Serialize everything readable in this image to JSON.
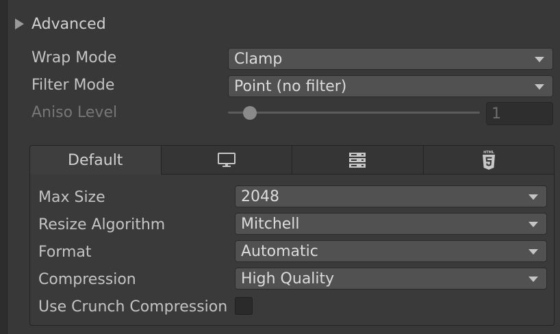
{
  "foldout": {
    "label": "Advanced",
    "expanded": false
  },
  "fields": {
    "wrap_mode": {
      "label": "Wrap Mode",
      "value": "Clamp"
    },
    "filter_mode": {
      "label": "Filter Mode",
      "value": "Point (no filter)"
    },
    "aniso_level": {
      "label": "Aniso Level",
      "value": "1",
      "slider_fraction": 0.06,
      "disabled": true
    }
  },
  "platform_tabs": [
    {
      "label": "Default",
      "icon": "",
      "active": true
    },
    {
      "label": "",
      "icon": "monitor-icon",
      "active": false
    },
    {
      "label": "",
      "icon": "server-icon",
      "active": false
    },
    {
      "label": "",
      "icon": "html5-icon",
      "active": false
    }
  ],
  "html5_icon_text": "HTML",
  "platform_fields": {
    "max_size": {
      "label": "Max Size",
      "value": "2048"
    },
    "resize_algorithm": {
      "label": "Resize Algorithm",
      "value": "Mitchell"
    },
    "format": {
      "label": "Format",
      "value": "Automatic"
    },
    "compression": {
      "label": "Compression",
      "value": "High Quality"
    },
    "use_crunch": {
      "label": "Use Crunch Compression",
      "checked": false
    }
  },
  "colors": {
    "background": "#383838",
    "dropdown": "#515151",
    "text": "#c4c4c4",
    "disabled_text": "#777777"
  }
}
